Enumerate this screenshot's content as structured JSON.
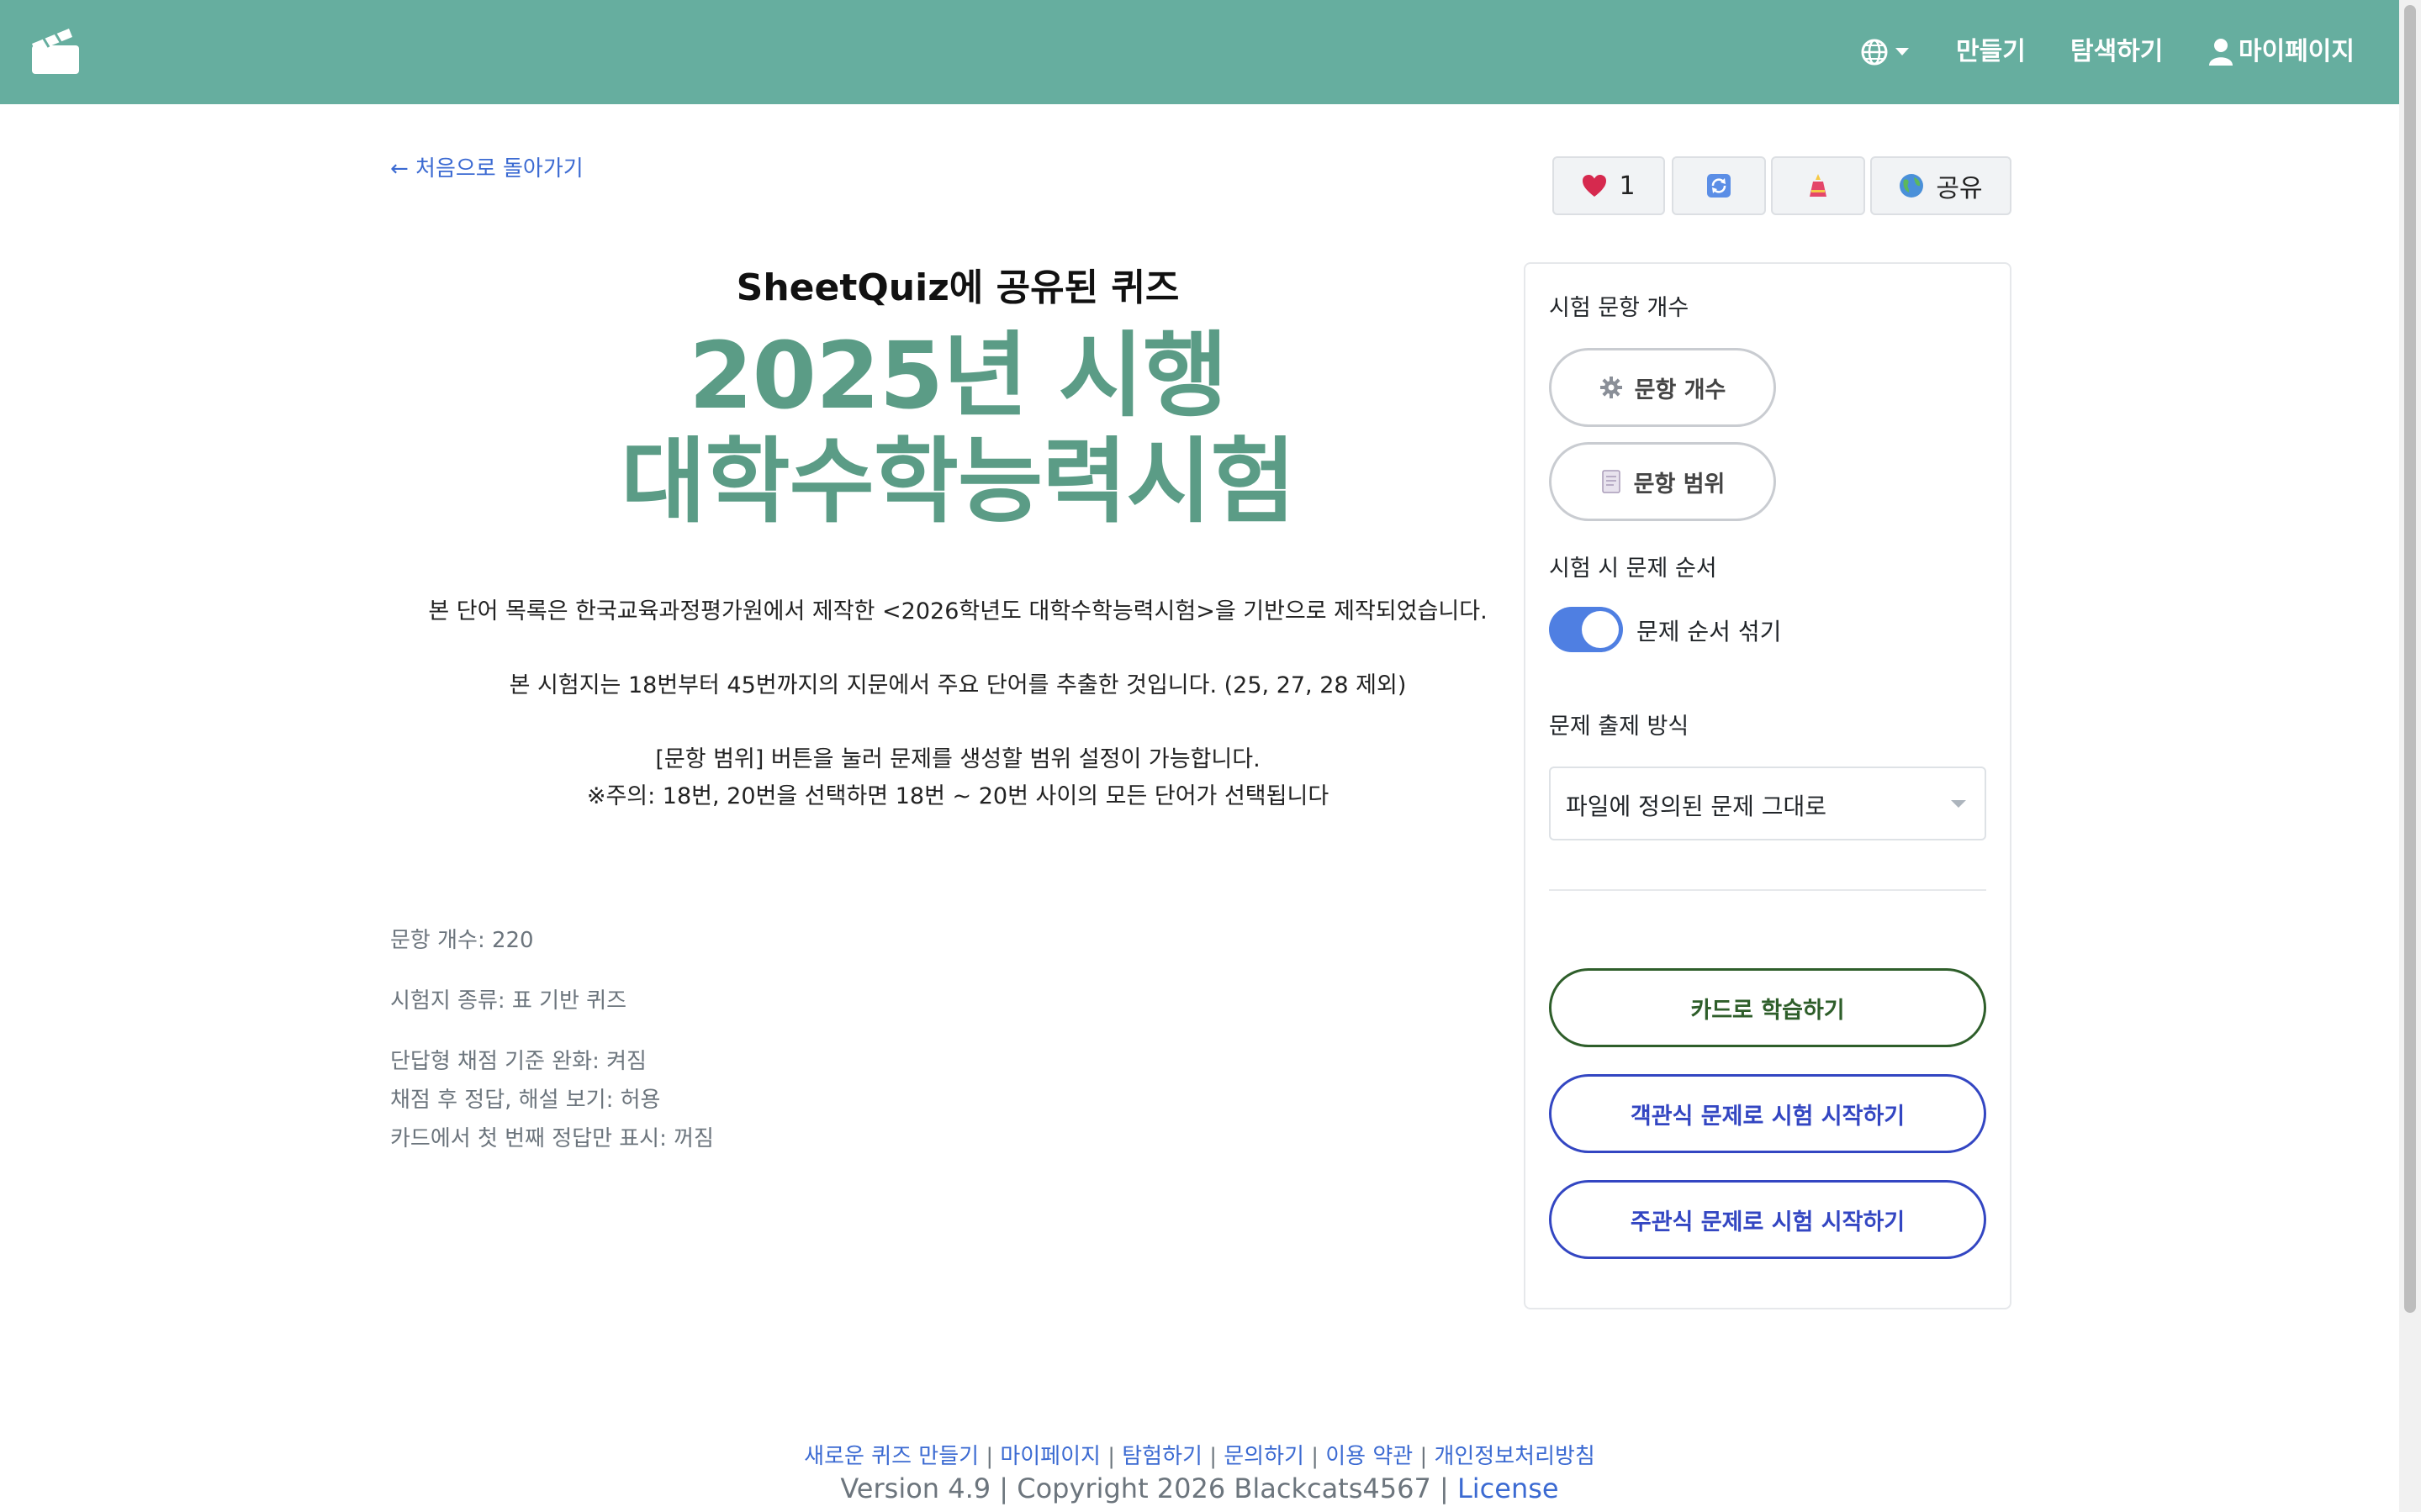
{
  "nav": {
    "make": "만들기",
    "explore": "탐색하기",
    "mypage": "마이페이지"
  },
  "back_link": "← 처음으로 돌아가기",
  "actions": {
    "like_count": "1",
    "share": "공유"
  },
  "quiz": {
    "subtitle": "SheetQuiz에 공유된 퀴즈",
    "title_line1": "2025년 시행",
    "title_line2": "대학수학능력시험",
    "desc": [
      "본 단어 목록은 한국교육과정평가원에서 제작한 <2026학년도 대학수학능력시험>을 기반으로 제작되었습니다.",
      "본 시험지는 18번부터 45번까지의 지문에서 주요 단어를 추출한 것입니다. (25, 27, 28 제외)",
      "[문항 범위] 버튼을 눌러 문제를 생성할 범위 설정이 가능합니다.",
      "※주의: 18번, 20번을 선택하면 18번 ~ 20번 사이의 모든 단어가 선택됩니다"
    ]
  },
  "meta": {
    "count": "문항 개수: 220",
    "type": "시험지 종류: 표 기반 퀴즈",
    "relaxed": "단답형 채점 기준 완화: 켜짐",
    "show_answer": "채점 후 정답, 해설 보기: 허용",
    "first_only": "카드에서 첫 번째 정답만 표시: 꺼짐"
  },
  "panel": {
    "count_label": "시험 문항 개수",
    "count_btn": "문항 개수",
    "range_btn": "문항 범위",
    "order_label": "시험 시 문제 순서",
    "shuffle_label": "문제 순서 섞기",
    "shuffle_on": true,
    "mode_label": "문제 출제 방식",
    "mode_value": "파일에 정의된 문제 그대로",
    "btn_card": "카드로 학습하기",
    "btn_mc": "객관식 문제로 시험 시작하기",
    "btn_sa": "주관식 문제로 시험 시작하기"
  },
  "footer": {
    "links": [
      "새로운 퀴즈 만들기",
      "마이페이지",
      "탐험하기",
      "문의하기",
      "이용 약관",
      "개인정보처리방침"
    ],
    "separator": "|",
    "version": "Version 4.9 | Copyright 2026 Blackcats4567 | ",
    "license": "License"
  },
  "colors": {
    "navbar": "#66ae9f",
    "title": "#5b9c86",
    "link": "#3b6ad2",
    "toggle": "#4f7fe2",
    "card_btn": "#2e5e2a",
    "test_btn": "#3346c2"
  },
  "icons": {
    "logo": "clapperboard-icon",
    "language": "globe-icon",
    "user": "user-icon",
    "like": "heart-icon",
    "reload": "refresh-icon",
    "ranking": "trophy-icon",
    "share": "earth-icon",
    "count": "gear-icon",
    "range": "note-icon"
  }
}
